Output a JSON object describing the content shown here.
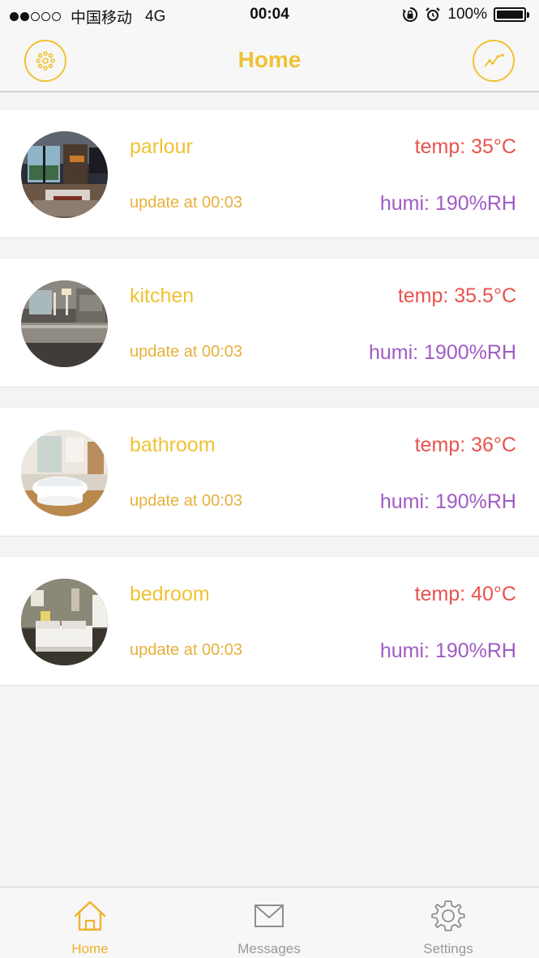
{
  "status_bar": {
    "signal_dots": [
      true,
      true,
      false,
      false,
      false
    ],
    "carrier": "中国移动",
    "network": "4G",
    "time": "00:04",
    "battery": "100%",
    "icons": [
      "rotation-lock-icon",
      "alarm-icon"
    ]
  },
  "nav": {
    "title": "Home",
    "left_icon": "light-dots-icon",
    "right_icon": "trend-chart-icon",
    "accent_color": "#f0c233"
  },
  "rooms": [
    {
      "name": "parlour",
      "update": "update at 00:03",
      "temp": "temp: 35°C",
      "humi": "humi: 190%RH",
      "photo": "living-room"
    },
    {
      "name": "kitchen",
      "update": "update at 00:03",
      "temp": "temp: 35.5°C",
      "humi": "humi: 1900%RH",
      "photo": "kitchen"
    },
    {
      "name": "bathroom",
      "update": "update at 00:03",
      "temp": "temp: 36°C",
      "humi": "humi: 190%RH",
      "photo": "bathroom"
    },
    {
      "name": "bedroom",
      "update": "update at 00:03",
      "temp": "temp: 40°C",
      "humi": "humi: 190%RH",
      "photo": "bedroom"
    }
  ],
  "colors": {
    "name": "#f0c233",
    "update": "#e8b03c",
    "temp": "#e8534e",
    "humi": "#a05bc4"
  },
  "tabs": [
    {
      "label": "Home",
      "icon": "home-icon",
      "active": true
    },
    {
      "label": "Messages",
      "icon": "envelope-icon",
      "active": false
    },
    {
      "label": "Settings",
      "icon": "gear-icon",
      "active": false
    }
  ]
}
